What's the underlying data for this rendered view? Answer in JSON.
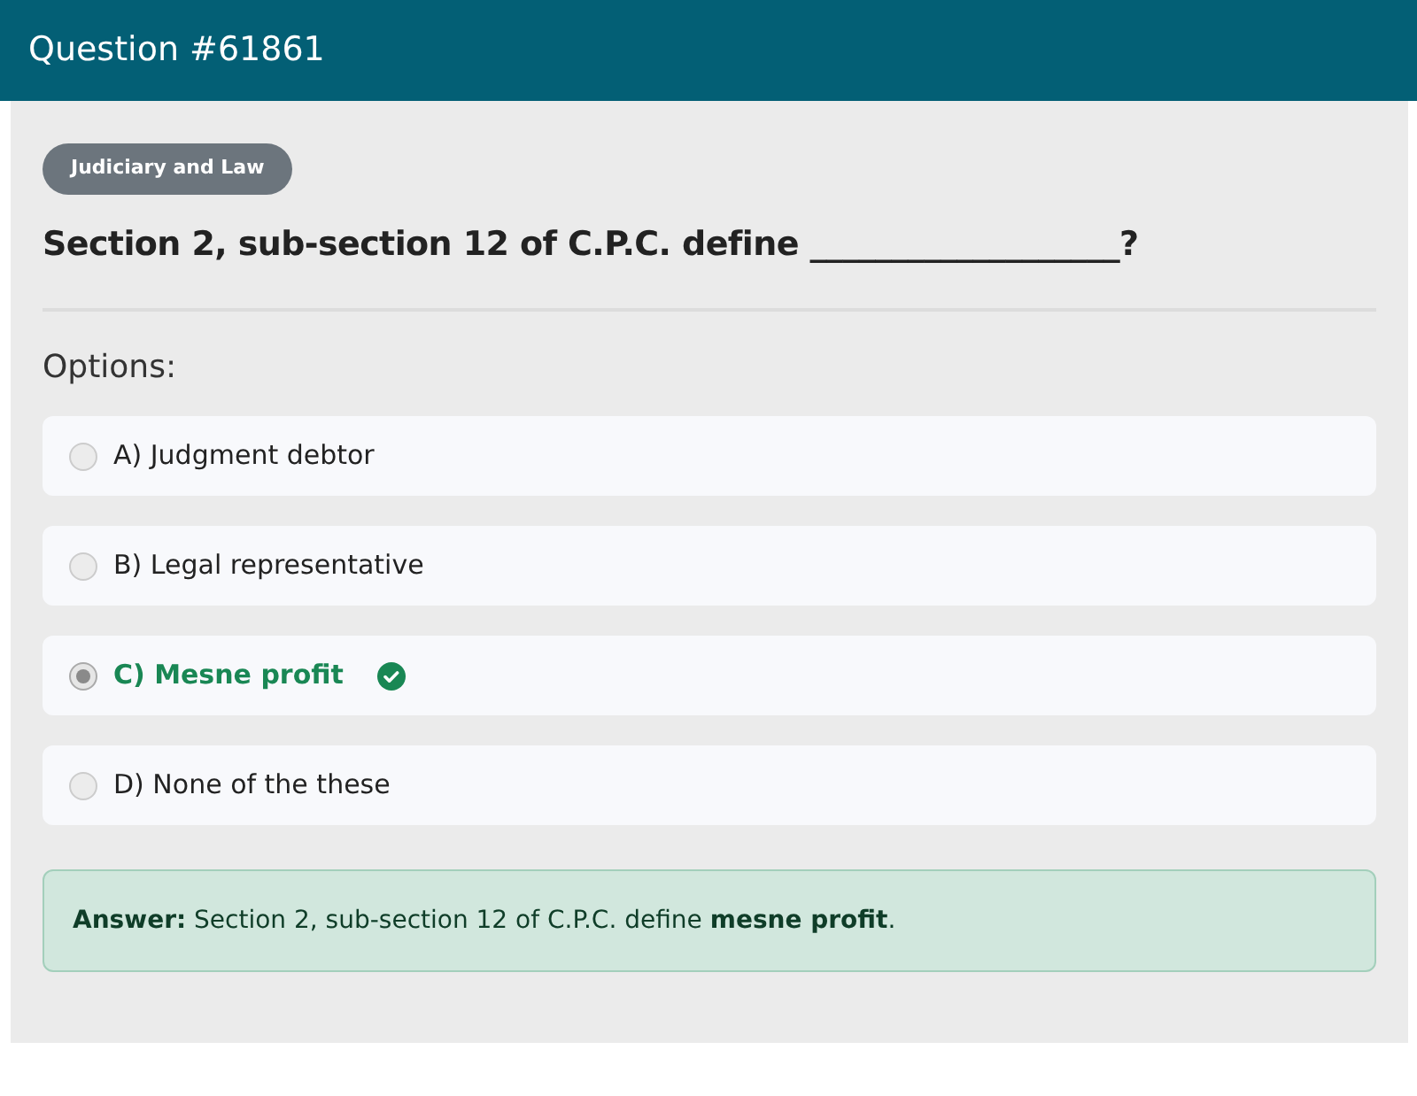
{
  "header": {
    "title": "Question #61861"
  },
  "category": "Judiciary and Law",
  "question": "Section 2, sub-section 12 of C.P.C. define ___________________?",
  "options_label": "Options:",
  "options": [
    {
      "label": "A) Judgment debtor",
      "selected": false,
      "correct": false
    },
    {
      "label": "B) Legal representative",
      "selected": false,
      "correct": false
    },
    {
      "label": "C) Mesne profit",
      "selected": true,
      "correct": true
    },
    {
      "label": "D) None of the these",
      "selected": false,
      "correct": false
    }
  ],
  "answer": "**Answer:** Section 2, sub-section 12 of C.P.C. define **mesne profit**."
}
